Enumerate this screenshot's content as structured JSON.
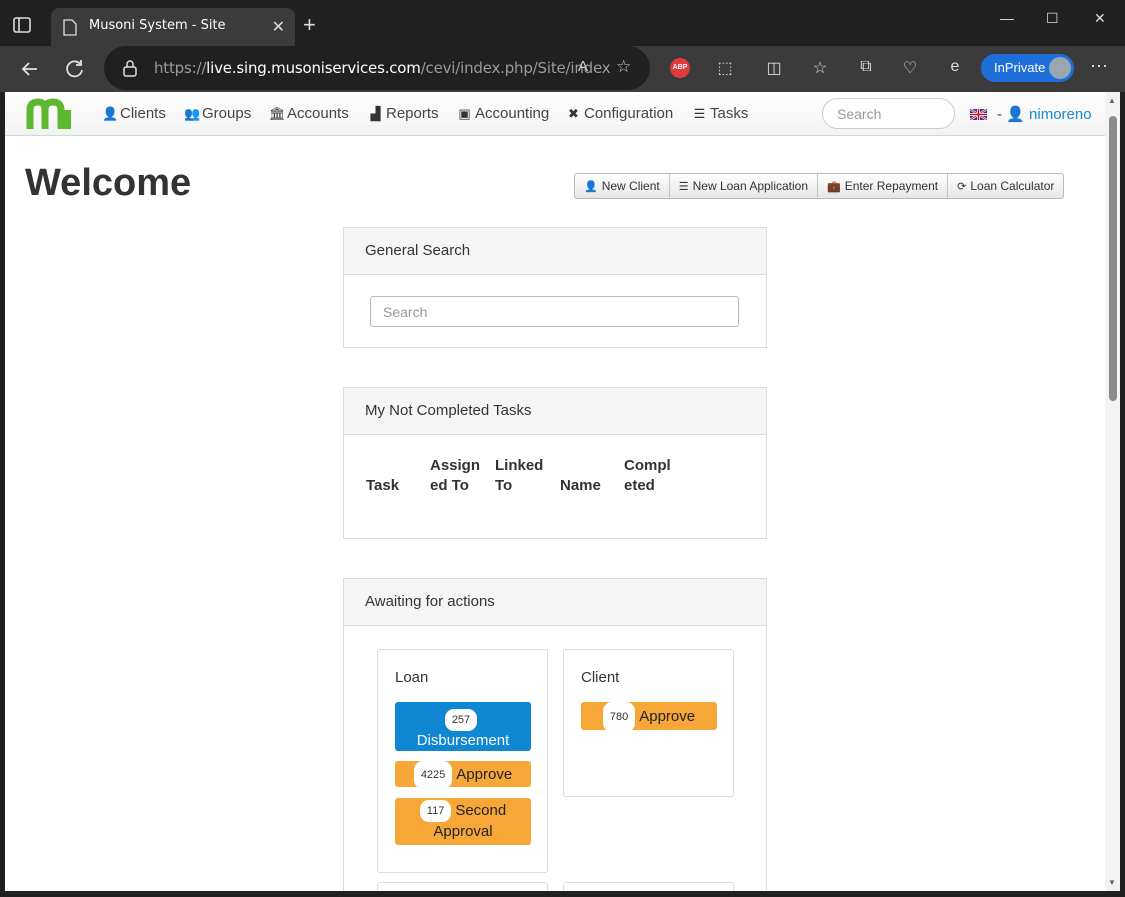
{
  "browser": {
    "tab_title": "Musoni System - Site",
    "url_prefix": "https://",
    "url_host": "live.sing.musoniservices.com",
    "url_path": "/cevi/index.php/Site/index",
    "inprivate_label": "InPrivate",
    "abp_label": "ABP"
  },
  "navbar": {
    "items": [
      {
        "label": "Clients",
        "icon": "person-icon"
      },
      {
        "label": "Groups",
        "icon": "group-icon"
      },
      {
        "label": "Accounts",
        "icon": "bank-icon"
      },
      {
        "label": "Reports",
        "icon": "bar-chart-icon"
      },
      {
        "label": "Accounting",
        "icon": "money-icon"
      },
      {
        "label": "Configuration",
        "icon": "wrench-icon"
      },
      {
        "label": "Tasks",
        "icon": "list-icon"
      }
    ],
    "search_placeholder": "Search",
    "separator": "-",
    "username": "nimoreno"
  },
  "page": {
    "title": "Welcome",
    "actions": [
      {
        "label": "New Client",
        "icon": "person-icon"
      },
      {
        "label": "New Loan Application",
        "icon": "list-icon"
      },
      {
        "label": "Enter Repayment",
        "icon": "briefcase-icon"
      },
      {
        "label": "Loan Calculator",
        "icon": "refresh-icon"
      }
    ]
  },
  "general_search": {
    "title": "General Search",
    "placeholder": "Search"
  },
  "tasks": {
    "title": "My Not Completed Tasks",
    "columns": [
      "Task",
      "Assign ed To",
      "Linked To",
      "Name",
      "Compl eted"
    ]
  },
  "awaiting": {
    "title": "Awaiting for actions",
    "loan": {
      "title": "Loan",
      "actions": [
        {
          "count": "257",
          "label": "Disbursement",
          "color": "#0f87d3"
        },
        {
          "count": "4225",
          "label": "Approve",
          "color": "#f7a737"
        },
        {
          "count": "117",
          "label": "Second Approval",
          "color": "#f7a737"
        }
      ]
    },
    "client": {
      "title": "Client",
      "actions": [
        {
          "count": "780",
          "label": "Approve",
          "color": "#f7a737"
        }
      ]
    }
  },
  "colors": {
    "accent": "#1a8bd1",
    "logo_green": "#5cb82f",
    "primary_blue": "#0f87d3",
    "warning_orange": "#f7a737"
  }
}
